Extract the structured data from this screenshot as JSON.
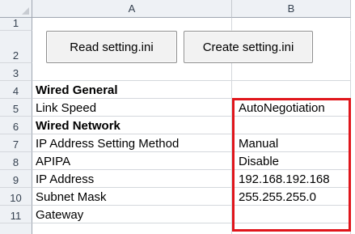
{
  "columns": [
    "A",
    "B"
  ],
  "rows": [
    {
      "num": "1",
      "a": "",
      "b": ""
    },
    {
      "num": "2",
      "a": "",
      "b": ""
    },
    {
      "num": "3",
      "a": "",
      "b": ""
    },
    {
      "num": "4",
      "a": "Wired General",
      "b": ""
    },
    {
      "num": "5",
      "a": "Link Speed",
      "b": "AutoNegotiation"
    },
    {
      "num": "6",
      "a": "Wired Network",
      "b": ""
    },
    {
      "num": "7",
      "a": "IP Address Setting Method",
      "b": "Manual"
    },
    {
      "num": "8",
      "a": "APIPA",
      "b": "Disable"
    },
    {
      "num": "9",
      "a": "IP Address",
      "b": "192.168.192.168"
    },
    {
      "num": "10",
      "a": "Subnet Mask",
      "b": "255.255.255.0"
    },
    {
      "num": "11",
      "a": "Gateway",
      "b": ""
    }
  ],
  "buttons": {
    "read": "Read setting.ini",
    "create": "Create setting.ini"
  },
  "colors": {
    "highlight_border": "#e0161c",
    "header_bg": "#eef1f5"
  }
}
